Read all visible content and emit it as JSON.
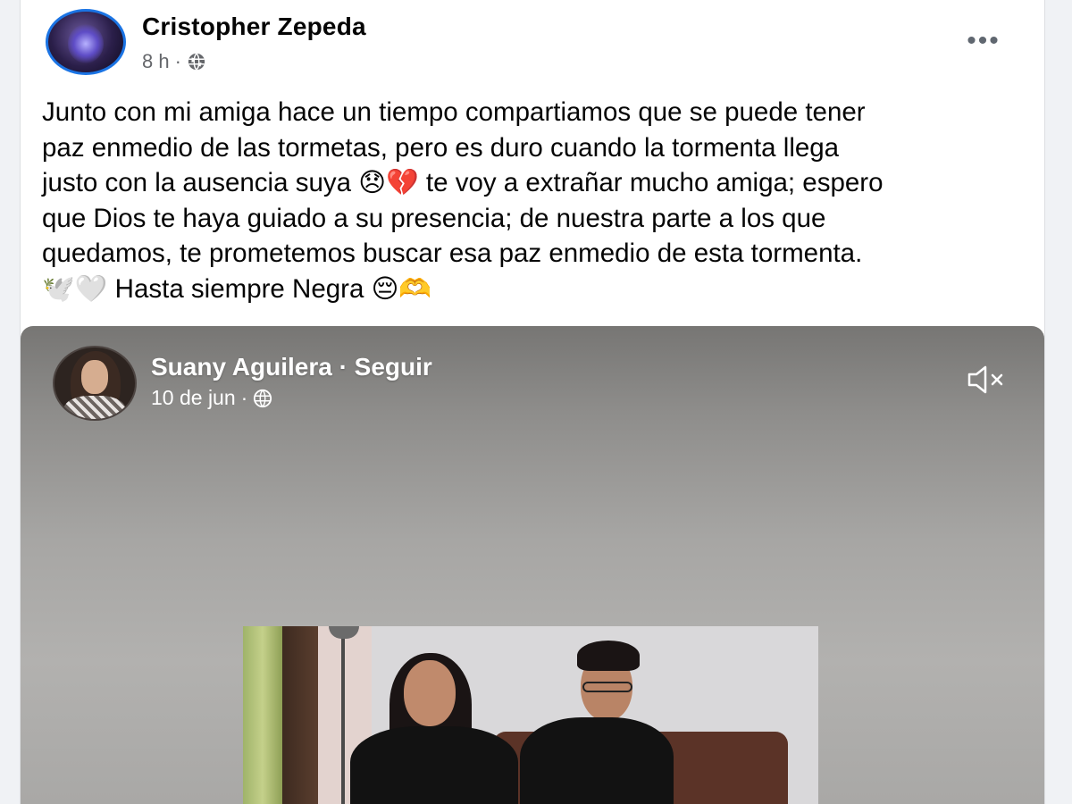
{
  "post": {
    "author": "Cristopher Zepeda",
    "time": "8 h",
    "separator": "·",
    "privacy_icon": "globe-icon",
    "more_label": "•••",
    "text_lines": [
      "Junto con mi amiga hace un tiempo compartiamos que se puede tener",
      "paz enmedio de las tormetas, pero es duro cuando la tormenta llega",
      "justo con la ausencia suya 😞💔 te voy a extrañar mucho amiga; espero",
      "que Dios te haya guiado a su presencia; de nuestra parte a los que",
      "quedamos, te prometemos buscar esa paz enmedio de esta tormenta.",
      "🕊️🤍 Hasta siempre Negra 😔🫶"
    ]
  },
  "shared": {
    "author": "Suany Aguilera · Seguir",
    "date": "10 de jun",
    "separator": "·",
    "privacy_icon": "globe-icon",
    "mute_icon": "speaker-muted-icon"
  }
}
